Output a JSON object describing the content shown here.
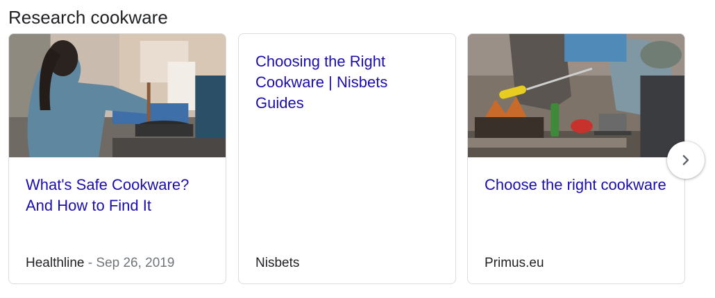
{
  "section": {
    "title": "Research cookware"
  },
  "cards": [
    {
      "title": "What's Safe Cookware? And How to Find It",
      "source": "Healthline",
      "separator": " - ",
      "date": "Sep 26, 2019",
      "image": "woman-cooking-at-stove"
    },
    {
      "title": "Choosing the Right Cookware | Nisbets Guides",
      "source": "Nisbets"
    },
    {
      "title": "Choose the right cookware",
      "source": "Primus.eu",
      "image": "campfire-cooking"
    }
  ],
  "navigation": {
    "next_icon": "chevron-right-icon"
  },
  "colors": {
    "link": "#1a0dab",
    "text": "#202124",
    "muted": "#70757a",
    "border": "#dadce0"
  }
}
